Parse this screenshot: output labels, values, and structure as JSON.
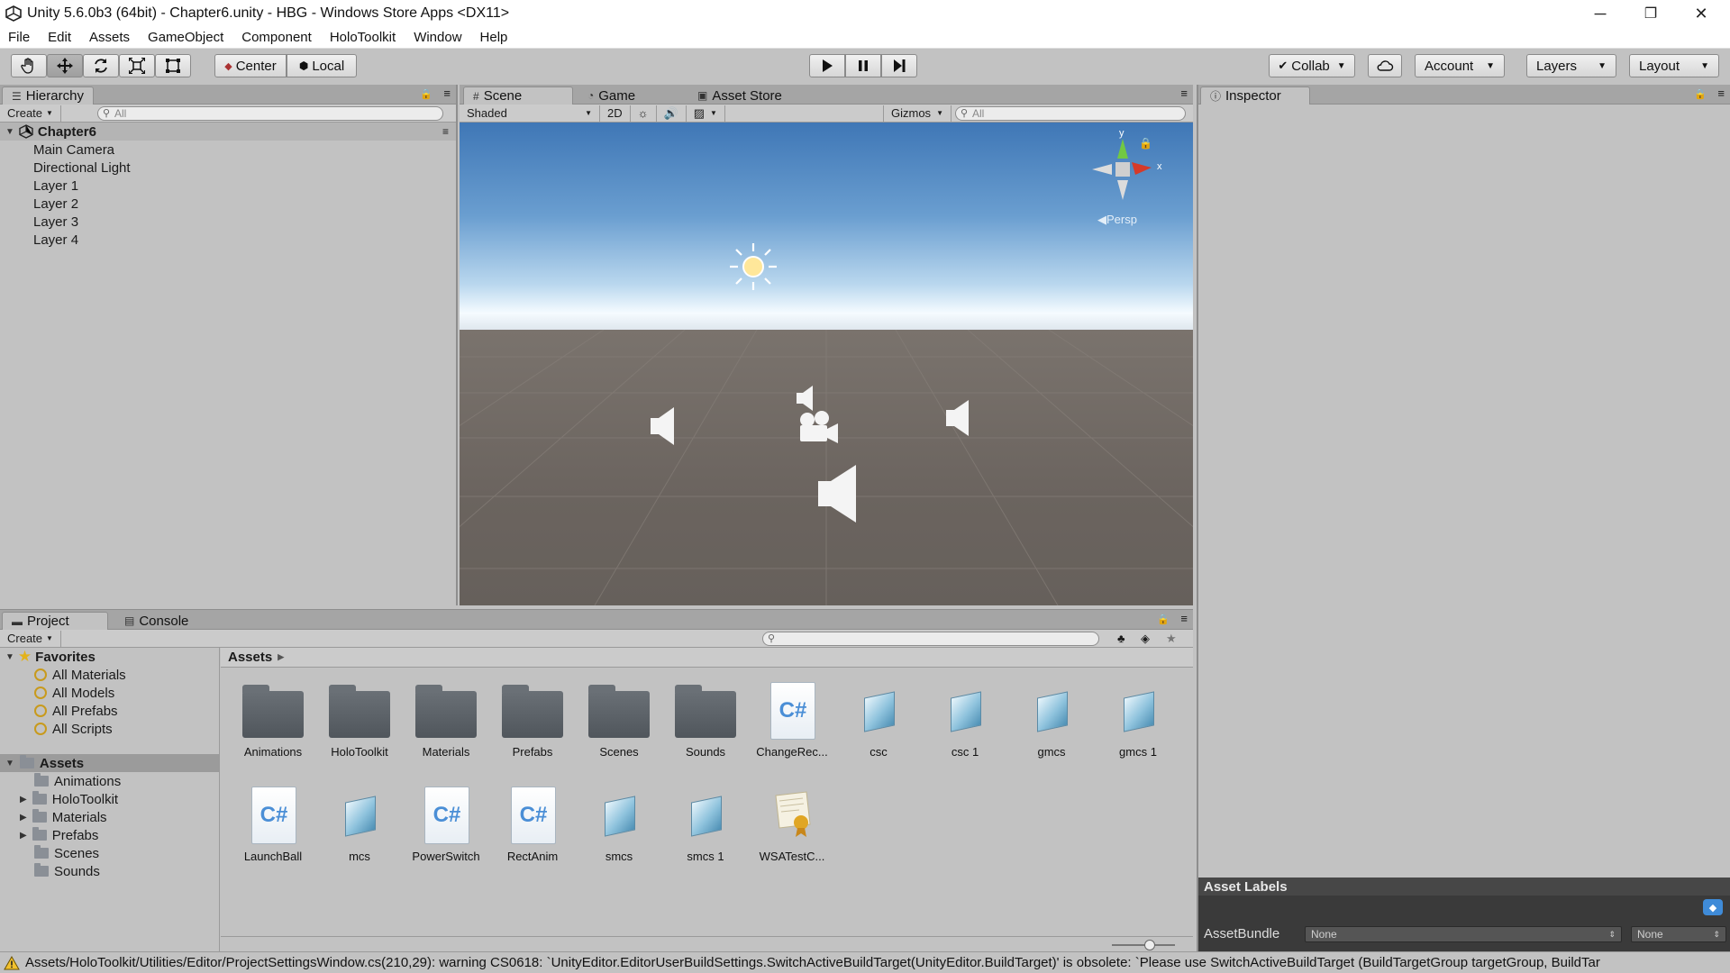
{
  "window": {
    "title": "Unity 5.6.0b3 (64bit) - Chapter6.unity - HBG - Windows Store Apps <DX11>",
    "minimize": "─",
    "restore": "❐",
    "close": "✕"
  },
  "menu": [
    "File",
    "Edit",
    "Assets",
    "GameObject",
    "Component",
    "HoloToolkit",
    "Window",
    "Help"
  ],
  "toolbar": {
    "tools": [
      "hand-tool",
      "move-tool",
      "rotate-tool",
      "scale-tool",
      "rect-tool"
    ],
    "pivot": "Center",
    "space": "Local",
    "collab": "Collab",
    "account": "Account",
    "layers": "Layers",
    "layout": "Layout"
  },
  "hierarchy": {
    "tab": "Hierarchy",
    "create": "Create",
    "search_placeholder": "All",
    "scene": "Chapter6",
    "items": [
      "Main Camera",
      "Directional Light",
      "Layer 1",
      "Layer 2",
      "Layer 3",
      "Layer 4"
    ]
  },
  "scene": {
    "tabs": [
      "Scene",
      "Game",
      "Asset Store"
    ],
    "shading": "Shaded",
    "mode_2d": "2D",
    "gizmos": "Gizmos",
    "search_placeholder": "All",
    "gizmo_axes": {
      "y": "y",
      "x": "x"
    },
    "persp": "Persp"
  },
  "inspector": {
    "tab": "Inspector",
    "asset_labels": "Asset Labels",
    "assetbundle_label": "AssetBundle",
    "assetbundle_value": "None",
    "variant_value": "None"
  },
  "project": {
    "tabs": [
      "Project",
      "Console"
    ],
    "create": "Create",
    "favorites": "Favorites",
    "favorite_items": [
      "All Materials",
      "All Models",
      "All Prefabs",
      "All Scripts"
    ],
    "assets_root": "Assets",
    "asset_folders": [
      "Animations",
      "HoloToolkit",
      "Materials",
      "Prefabs",
      "Scenes",
      "Sounds"
    ],
    "breadcrumb": "Assets",
    "grid_row1": [
      "Animations",
      "HoloToolkit",
      "Materials",
      "Prefabs",
      "Scenes",
      "Sounds",
      "ChangeRec...",
      "csc",
      "csc 1",
      "gmcs",
      "gmcs 1"
    ],
    "grid_row2": [
      "LaunchBall",
      "mcs",
      "PowerSwitch",
      "RectAnim",
      "smcs",
      "smcs 1",
      "WSATestC..."
    ]
  },
  "status": {
    "message": "Assets/HoloToolkit/Utilities/Editor/ProjectSettingsWindow.cs(210,29): warning CS0618: `UnityEditor.EditorUserBuildSettings.SwitchActiveBuildTarget(UnityEditor.BuildTarget)' is obsolete: `Please use SwitchActiveBuildTarget (BuildTargetGroup targetGroup, BuildTar"
  }
}
